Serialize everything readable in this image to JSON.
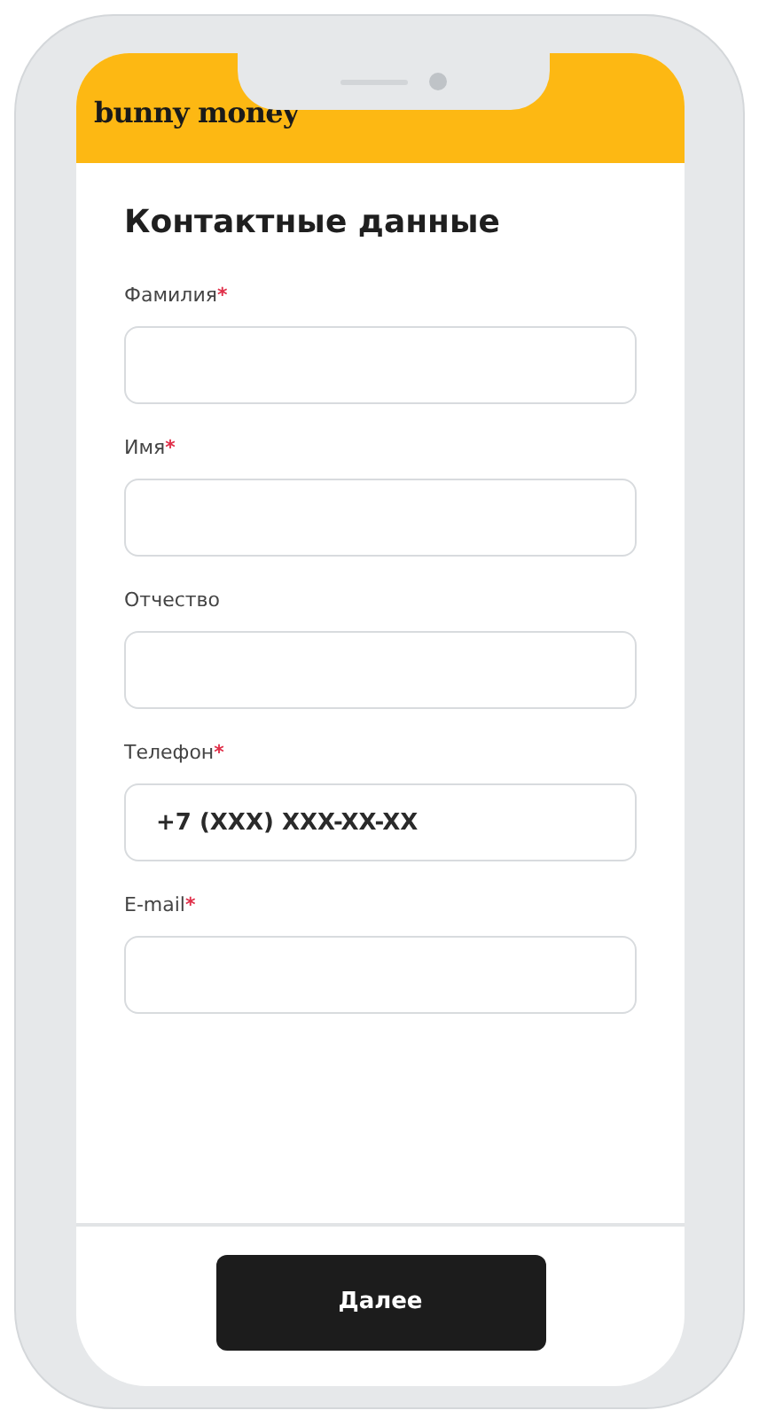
{
  "header": {
    "logo": "bunny money"
  },
  "title": "Контактные данные",
  "fields": [
    {
      "label": "Фамилия",
      "required_mark": "*"
    },
    {
      "label": "Имя",
      "required_mark": "*"
    },
    {
      "label": "Отчество"
    },
    {
      "label": "Телефон",
      "required_mark": "*",
      "value": "+7 (XXX) XXX-XX-XX"
    },
    {
      "label": "E-mail",
      "required_mark": "*"
    }
  ],
  "next_button": "Далее"
}
